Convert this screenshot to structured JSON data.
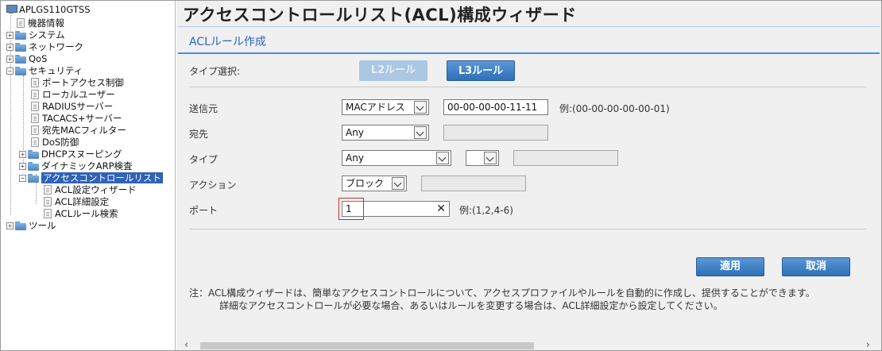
{
  "sidebar": {
    "root": "APLGS110GTSS",
    "items": [
      {
        "label": "機器情報"
      },
      {
        "label": "システム"
      },
      {
        "label": "ネットワーク"
      },
      {
        "label": "QoS"
      },
      {
        "label": "セキュリティ"
      },
      {
        "label": "ポートアクセス制御"
      },
      {
        "label": "ローカルユーザー"
      },
      {
        "label": "RADIUSサーバー"
      },
      {
        "label": "TACACS+サーバー"
      },
      {
        "label": "宛先MACフィルター"
      },
      {
        "label": "DoS防御"
      },
      {
        "label": "DHCPスヌーピング"
      },
      {
        "label": "ダイナミックARP検査"
      },
      {
        "label": "アクセスコントロールリスト"
      },
      {
        "label": "ACL設定ウィザード"
      },
      {
        "label": "ACL詳細設定"
      },
      {
        "label": "ACLルール検索"
      },
      {
        "label": "ツール"
      }
    ]
  },
  "page": {
    "title": "アクセスコントロールリスト(ACL)構成ウィザード",
    "section_title": "ACLルール作成"
  },
  "form": {
    "type_select_label": "タイプ選択:",
    "l2_button": "L2ルール",
    "l3_button": "L3ルール",
    "source_label": "送信元",
    "source_type": "MACアドレス",
    "source_value": "00-00-00-00-11-11",
    "source_hint": "例:(00-00-00-00-00-01)",
    "dest_label": "宛先",
    "dest_type": "Any",
    "type_label": "タイプ",
    "type_value": "Any",
    "type_sub_value": "",
    "action_label": "アクション",
    "action_value": "ブロック",
    "port_label": "ポート",
    "port_value": "1",
    "port_clear": "✕",
    "port_hint": "例:(1,2,4-6)"
  },
  "actions": {
    "apply": "適用",
    "cancel": "取消"
  },
  "note": {
    "line1": "注：ACL構成ウィザードは、簡単なアクセスコントロールについて、アクセスプロファイルやルールを自動的に作成し、提供することができます。",
    "line2": "詳細なアクセスコントロールが必要な場合、あるいはルールを変更する場合は、ACL詳細設定から設定してください。"
  },
  "colors": {
    "accent": "#2b63c1",
    "button": "#3c7cc4",
    "selected": "#2f62b8",
    "focus": "#d42a2a"
  }
}
